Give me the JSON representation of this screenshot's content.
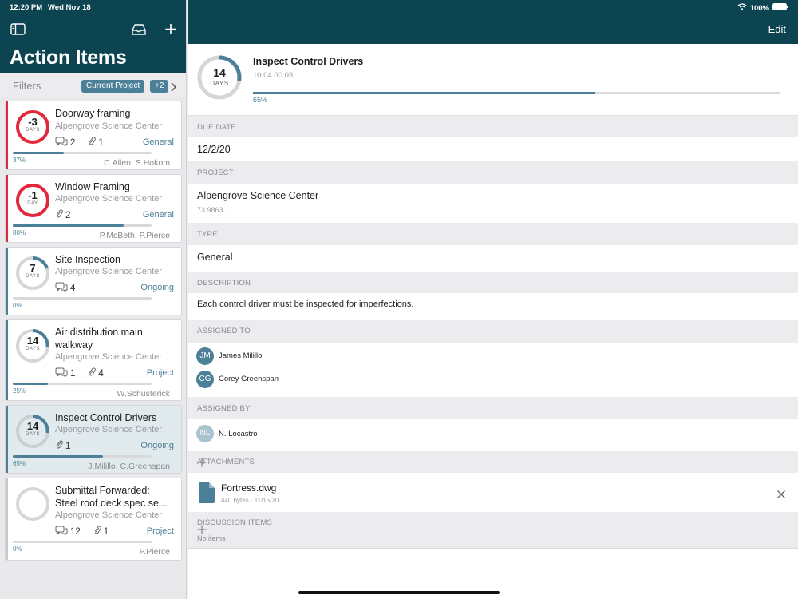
{
  "status": {
    "time": "12:20 PM",
    "date": "Wed Nov 18",
    "battery": "100%"
  },
  "sidebar": {
    "title": "Action Items",
    "filters_label": "Filters",
    "filter_chips": [
      "Current Project",
      "+2"
    ],
    "cards": [
      {
        "title": "Doorway framing",
        "project": "Alpengrove Science Center",
        "days": "-3",
        "unit": "DAYS",
        "comments": "2",
        "attachments": "1",
        "type": "General",
        "progress": 0.37,
        "progress_label": "37%",
        "assignees": "C.Allen, S.Hokom",
        "status_color": "#e2283b"
      },
      {
        "title": "Window Framing",
        "project": "Alpengrove Science Center",
        "days": "-1",
        "unit": "DAY",
        "comments": "",
        "attachments": "2",
        "type": "General",
        "progress": 0.8,
        "progress_label": "80%",
        "assignees": "P.McBeth, P.Pierce",
        "status_color": "#e2283b"
      },
      {
        "title": "Site Inspection",
        "project": "Alpengrove Science Center",
        "days": "7",
        "unit": "DAYS",
        "comments": "4",
        "attachments": "",
        "type": "Ongoing",
        "progress": 0.0,
        "progress_label": "0%",
        "assignees": "",
        "status_color": "#4c8098"
      },
      {
        "title": "Air distribution main walkway",
        "project": "Alpengrove Science Center",
        "days": "14",
        "unit": "DAYS",
        "comments": "1",
        "attachments": "4",
        "type": "Project",
        "progress": 0.25,
        "progress_label": "25%",
        "assignees": "W.Schusterick",
        "status_color": "#4c8098"
      },
      {
        "title": "Inspect Control Drivers",
        "project": "Alpengrove Science Center",
        "days": "14",
        "unit": "DAYS",
        "comments": "",
        "attachments": "1",
        "type": "Ongoing",
        "progress": 0.65,
        "progress_label": "65%",
        "assignees": "J.Milillo, C.Greenspan",
        "status_color": "#4c8098"
      },
      {
        "title": "Submittal Forwarded: Steel roof deck spec se...",
        "project": "Alpengrove Science Center",
        "days": "",
        "unit": "",
        "comments": "12",
        "attachments": "1",
        "type": "Project",
        "progress": 0.0,
        "progress_label": "0%",
        "assignees": "P.Pierce",
        "status_color": "#c8c8cc"
      }
    ]
  },
  "detail": {
    "edit_label": "Edit",
    "summary": {
      "days": "14",
      "unit": "DAYS",
      "title": "Inspect Control Drivers",
      "code": "10.04.00.03",
      "progress": 0.65,
      "progress_label": "65%"
    },
    "due_date": {
      "label": "DUE DATE",
      "value": "12/2/20"
    },
    "project": {
      "label": "PROJECT",
      "value": "Alpengrove Science Center",
      "code": "73.9863.1"
    },
    "type": {
      "label": "TYPE",
      "value": "General"
    },
    "description": {
      "label": "DESCRIPTION",
      "value": "Each control driver must be inspected for imperfections."
    },
    "assigned_to": {
      "label": "ASSIGNED TO",
      "people": [
        {
          "initials": "JM",
          "name": "James Milillo"
        },
        {
          "initials": "CG",
          "name": "Corey Greenspan"
        }
      ]
    },
    "assigned_by": {
      "label": "ASSIGNED BY",
      "initials": "NL",
      "name": "N. Locastro"
    },
    "attachments": {
      "label": "ATTACHMENTS",
      "file_name": "Fortress.dwg",
      "file_meta": "440 bytes · 11/15/20"
    },
    "discussion": {
      "label": "DISCUSSION ITEMS",
      "empty": "No items"
    }
  }
}
